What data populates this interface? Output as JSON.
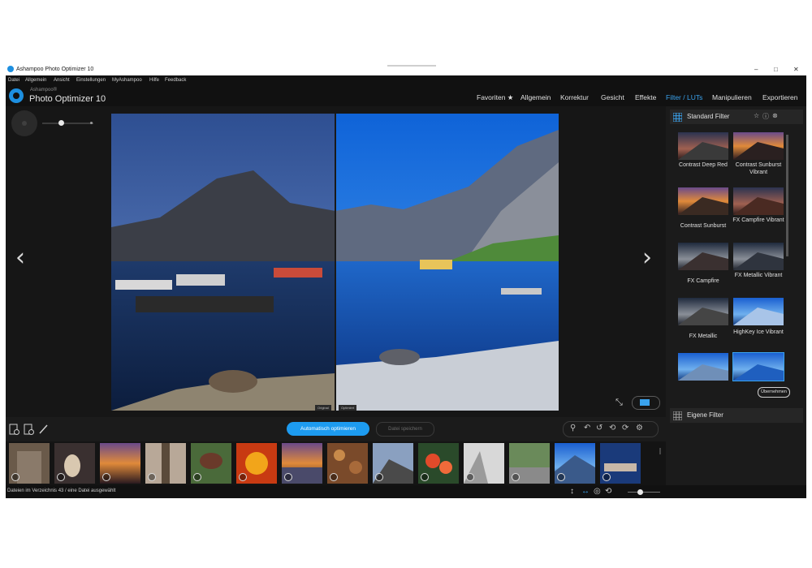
{
  "window": {
    "title": "Ashampoo Photo Optimizer 10",
    "controls": [
      "–",
      "□",
      "✕"
    ]
  },
  "menu": [
    "Datei",
    "Allgemein",
    "Ansicht",
    "Einstellungen",
    "MyAshampoo",
    "Hilfe",
    "Feedback"
  ],
  "brand": {
    "small": "Ashampoo®",
    "name": "Photo Optimizer 10"
  },
  "tabs": [
    "Favoriten ★",
    "Allgemein",
    "Korrektur",
    "Gesicht",
    "Effekte",
    "Filter / LUTs",
    "Manipulieren",
    "Exportieren"
  ],
  "active_tab_index": 5,
  "compare": {
    "left": "Original",
    "right": "Optimiert"
  },
  "filters_panel": {
    "title": "Standard Filter",
    "items": [
      "Contrast Deep Red",
      "Contrast Sunburst Vibrant",
      "Contrast Sunburst",
      "FX Campfire Vibrant",
      "FX Campfire",
      "FX Metallic Vibrant",
      "FX Metallic",
      "HighKey Ice Vibrant",
      "",
      ""
    ],
    "selected_index": 9,
    "apply_button": "Übernehmen",
    "own_filters_title": "Eigene Filter"
  },
  "toolbar": {
    "auto_optimize": "Automatisch optimieren",
    "save_file": "Datei speichern"
  },
  "filmstrip_count": 14,
  "status": {
    "text": "Dateien im Verzeichnis 43 / eine Datei ausgewählt"
  },
  "colors": {
    "accent": "#1d9bf0",
    "active_tab": "#3aa3ee",
    "background": "#161616"
  },
  "icons": [
    "add-photo-icon",
    "add-folder-icon",
    "brush-icon",
    "magic-wand-icon",
    "undo-icon",
    "undo-all-icon",
    "rotate-left-icon",
    "rotate-right-icon",
    "settings-icon"
  ]
}
